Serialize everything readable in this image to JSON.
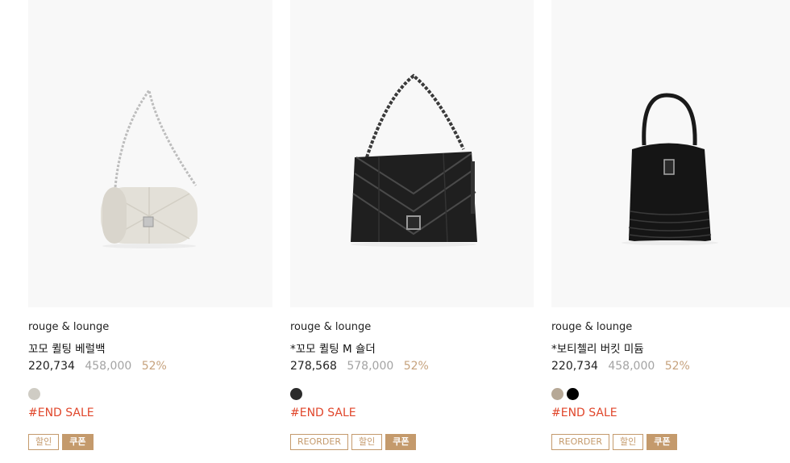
{
  "products": [
    {
      "brand": "rouge & lounge",
      "name": "꼬모 퀼팅 베럴백",
      "sale_price": "220,734",
      "original_price": "458,000",
      "discount": "52%",
      "colors": [
        "#cfccc4"
      ],
      "tag": "#END SALE",
      "badges": [
        "할인",
        "쿠폰"
      ]
    },
    {
      "brand": "rouge & lounge",
      "name": "*꼬모 퀼팅 M 숄더",
      "sale_price": "278,568",
      "original_price": "578,000",
      "discount": "52%",
      "colors": [
        "#2b2b2b"
      ],
      "tag": "#END SALE",
      "badges": [
        "REORDER",
        "할인",
        "쿠폰"
      ]
    },
    {
      "brand": "rouge & lounge",
      "name": "*보티첼리 버킷 미듐",
      "sale_price": "220,734",
      "original_price": "458,000",
      "discount": "52%",
      "colors": [
        "#b6a896",
        "#000000"
      ],
      "tag": "#END SALE",
      "badges": [
        "REORDER",
        "할인",
        "쿠폰"
      ]
    }
  ]
}
